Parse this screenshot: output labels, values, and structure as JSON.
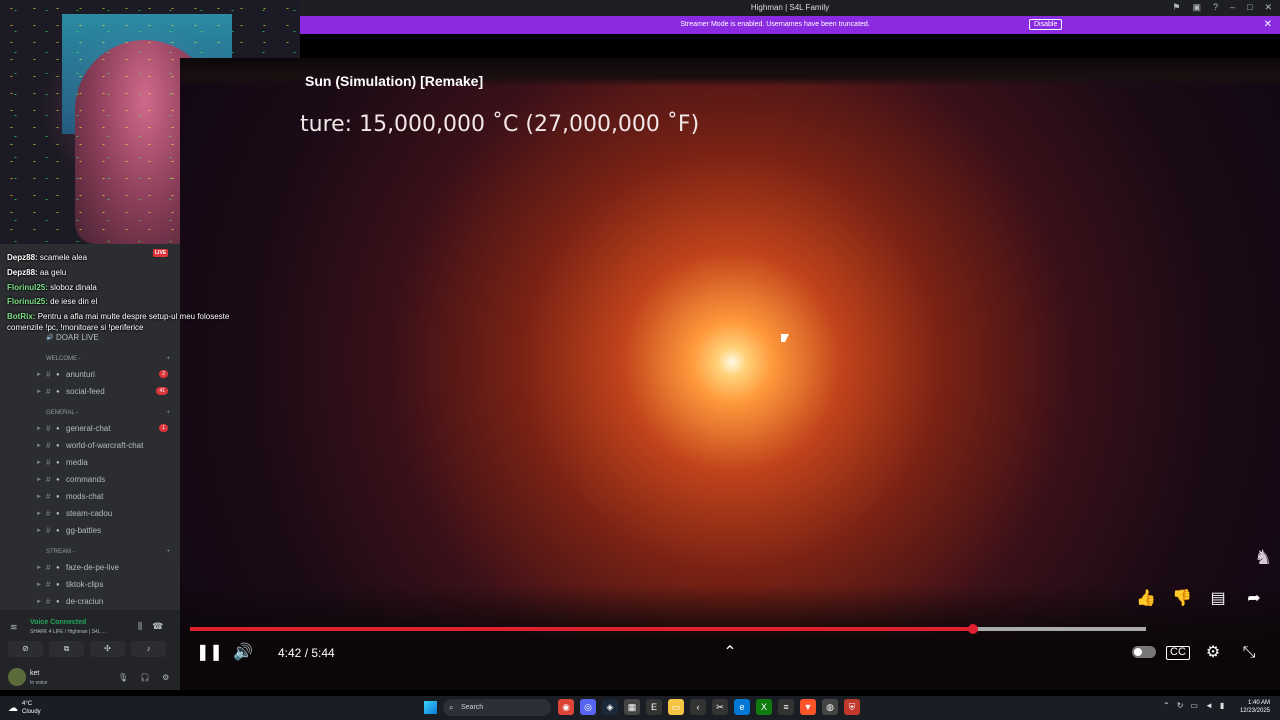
{
  "window": {
    "title": "Highman | S4L Family"
  },
  "banner": {
    "message": "Streamer Mode is enabled. Usernames have been truncated.",
    "disable_label": "Disable"
  },
  "video": {
    "title": "Sun (Simulation) [Remake]",
    "temperature_text": "ture: 15,000,000 ˚C  (27,000,000 ˚F)",
    "current_time": "4:42",
    "duration": "5:44",
    "time_display": "4:42 / 5:44",
    "progress_fraction": 0.8188
  },
  "chat": {
    "live_label": "LIVE",
    "messages": [
      {
        "user": "Depz88:",
        "text": "scamele alea",
        "color": "#ffffff"
      },
      {
        "user": "Depz88:",
        "text": "aa gelu",
        "color": "#ffffff"
      },
      {
        "user": "Florinul25:",
        "text": "sloboz dinala",
        "color": "#7fe08a"
      },
      {
        "user": "Florinul25:",
        "text": "de iese din el",
        "color": "#7fe08a"
      },
      {
        "user": "BotRix:",
        "text": "Pentru a afla mai multe despre setup-ul meu foloseste",
        "color": "#7fe08a"
      },
      {
        "user": "",
        "text": "comenzile !pc, !monitoare si !periferice",
        "color": "#ffffff"
      }
    ]
  },
  "discord": {
    "top_channel": "DOAR LIVE",
    "categories": [
      {
        "name": "WELCOME -",
        "channels": [
          {
            "label": "anunturi",
            "badge": "2"
          },
          {
            "label": "social-feed",
            "badge": "41"
          }
        ]
      },
      {
        "name": "GENERAL -",
        "channels": [
          {
            "label": "general-chat",
            "badge": "1"
          },
          {
            "label": "world-of-warcraft-chat",
            "badge": ""
          },
          {
            "label": "media",
            "badge": ""
          },
          {
            "label": "commands",
            "badge": ""
          },
          {
            "label": "mods-chat",
            "badge": ""
          },
          {
            "label": "steam-cadou",
            "badge": ""
          },
          {
            "label": "gg-battles",
            "badge": ""
          }
        ]
      },
      {
        "name": "STREAM -",
        "channels": [
          {
            "label": "faze-de-pe-live",
            "badge": ""
          },
          {
            "label": "tiktok-clips",
            "badge": ""
          },
          {
            "label": "de-craciun",
            "badge": ""
          }
        ]
      }
    ],
    "voice": {
      "status": "Voice Connected",
      "server": "SHARK 4 LIFE / Highman | S4L ..."
    },
    "user": {
      "name": "ket",
      "status": "In voice"
    }
  },
  "taskbar": {
    "weather_temp": "4°C",
    "weather_desc": "Cloudy",
    "search_placeholder": "Search",
    "time": "1:40 AM",
    "date": "12/23/2025"
  },
  "colors": {
    "accent": "#8a2be2",
    "progress": "#e0212f",
    "discord_bg": "#2b2d31"
  }
}
